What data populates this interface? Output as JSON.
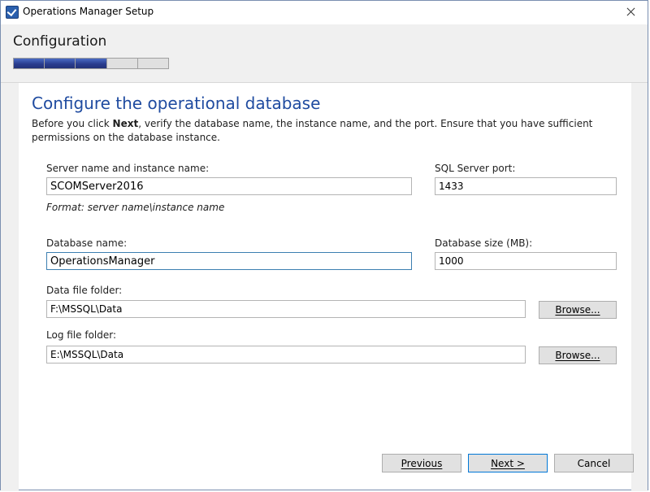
{
  "window": {
    "title": "Operations Manager Setup",
    "icon": "setup-app-icon",
    "close_icon": "close-icon"
  },
  "header": {
    "stage": "Configuration",
    "progress": {
      "total_steps": 5,
      "completed_steps": 3
    }
  },
  "page": {
    "heading": "Configure the operational database",
    "intro_before": "Before you click ",
    "intro_bold": "Next",
    "intro_after": ", verify the database name, the instance name, and the port. Ensure that you have sufficient permissions on the database instance."
  },
  "form": {
    "server_label": "Server name and instance name:",
    "server_value": "SCOMServer2016",
    "server_hint": "Format: server name\\instance name",
    "port_label": "SQL Server port:",
    "port_value": "1433",
    "dbname_label": "Database name:",
    "dbname_value": "OperationsManager",
    "dbsize_label": "Database size (MB):",
    "dbsize_value": "1000",
    "datafolder_label": "Data file folder:",
    "datafolder_value": "F:\\MSSQL\\Data",
    "logfolder_label": "Log file folder:",
    "logfolder_value": "E:\\MSSQL\\Data",
    "browse_label": "Browse..."
  },
  "footer": {
    "previous_label": "Previous",
    "next_label": "Next >",
    "cancel_label": "Cancel"
  },
  "colors": {
    "heading": "#1f4ba0",
    "progress_fill": "#2a3d8f",
    "header_band": "#f0f0f0",
    "focus_border": "#3c7fb1"
  }
}
